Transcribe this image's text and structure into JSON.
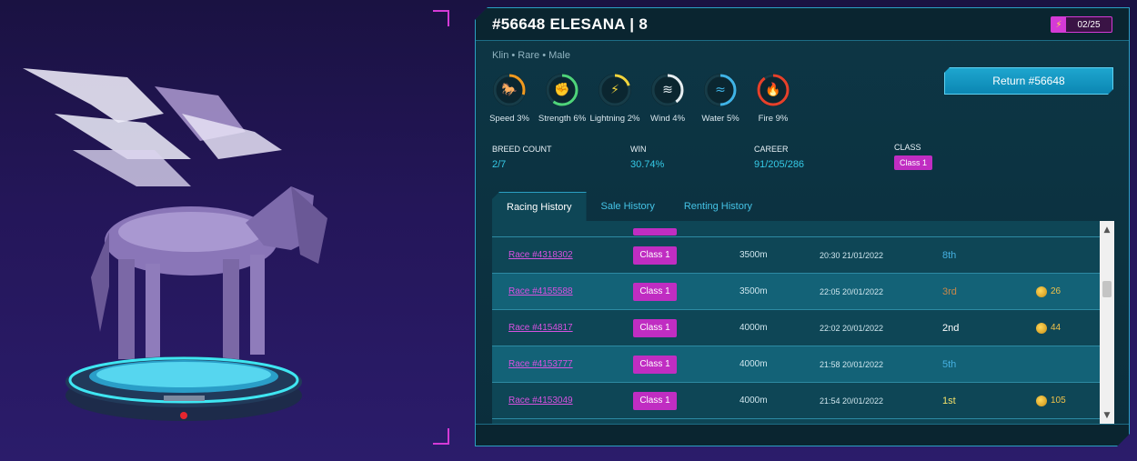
{
  "horse": {
    "title": "#56648 ELESANA | 8",
    "energy": "02/25",
    "subtitle": "Klin  •  Rare  •  Male",
    "return_label": "Return #56648"
  },
  "stats": [
    {
      "name": "speed",
      "label": "Speed  3%",
      "color": "#f19a1f",
      "icon": "horse-icon",
      "percent": 0.3
    },
    {
      "name": "strength",
      "label": "Strength  6%",
      "color": "#4ed37a",
      "icon": "fist-icon",
      "percent": 0.6
    },
    {
      "name": "lightning",
      "label": "Lightning  2%",
      "color": "#f2d43c",
      "icon": "lightning-icon",
      "percent": 0.2
    },
    {
      "name": "wind",
      "label": "Wind  4%",
      "color": "#e6eef2",
      "icon": "wind-icon",
      "percent": 0.4
    },
    {
      "name": "water",
      "label": "Water  5%",
      "color": "#3fb3e6",
      "icon": "water-icon",
      "percent": 0.5
    },
    {
      "name": "fire",
      "label": "Fire  9%",
      "color": "#e6402a",
      "icon": "fire-icon",
      "percent": 0.9
    }
  ],
  "info": {
    "breed_label": "BREED COUNT",
    "breed_value": "2/7",
    "win_label": "WIN",
    "win_value": "30.74%",
    "career_label": "CAREER",
    "career_value": "91/205/286",
    "class_label": "CLASS",
    "class_value": "Class 1"
  },
  "tabs": [
    "Racing History",
    "Sale History",
    "Renting History"
  ],
  "rows": [
    {
      "race": "Race #4318302",
      "class": "Class 1",
      "distance": "3500m",
      "time": "20:30 21/01/2022",
      "place": "8th",
      "place_color": "#45b0e0",
      "reward": ""
    },
    {
      "race": "Race #4155588",
      "class": "Class 1",
      "distance": "3500m",
      "time": "22:05 20/01/2022",
      "place": "3rd",
      "place_color": "#c9884a",
      "reward": "26"
    },
    {
      "race": "Race #4154817",
      "class": "Class 1",
      "distance": "4000m",
      "time": "22:02 20/01/2022",
      "place": "2nd",
      "place_color": "#ffffff",
      "reward": "44"
    },
    {
      "race": "Race #4153777",
      "class": "Class 1",
      "distance": "4000m",
      "time": "21:58 20/01/2022",
      "place": "5th",
      "place_color": "#45b0e0",
      "reward": ""
    },
    {
      "race": "Race #4153049",
      "class": "Class 1",
      "distance": "4000m",
      "time": "21:54 20/01/2022",
      "place": "1st",
      "place_color": "#f2e06a",
      "reward": "105"
    }
  ]
}
